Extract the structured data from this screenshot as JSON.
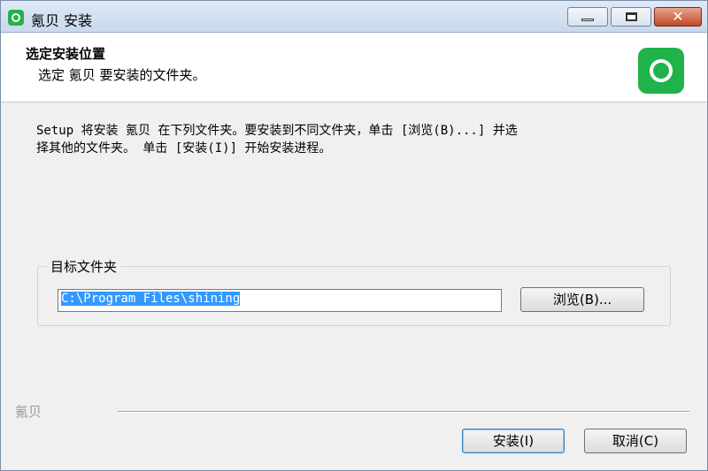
{
  "window": {
    "title": "氪贝 安装",
    "controls": {
      "minimize": "",
      "maximize": "",
      "close": "✕"
    }
  },
  "header": {
    "title": "选定安装位置",
    "subtitle": "选定 氪贝 要安装的文件夹。",
    "logo_icon": "app-logo-icon"
  },
  "body": {
    "description": "Setup 将安装 氪贝 在下列文件夹。要安装到不同文件夹，单击 [浏览(B)...] 并选\n择其他的文件夹。 单击 [安装(I)] 开始安装进程。"
  },
  "destination": {
    "group_label": "目标文件夹",
    "path": "C:\\Program Files\\shining",
    "browse_label": "浏览(B)..."
  },
  "footer": {
    "brand": "氪贝",
    "install_label": "安装(I)",
    "cancel_label": "取消(C)"
  },
  "colors": {
    "accent": "#1fb34a",
    "selection": "#3399ff"
  }
}
